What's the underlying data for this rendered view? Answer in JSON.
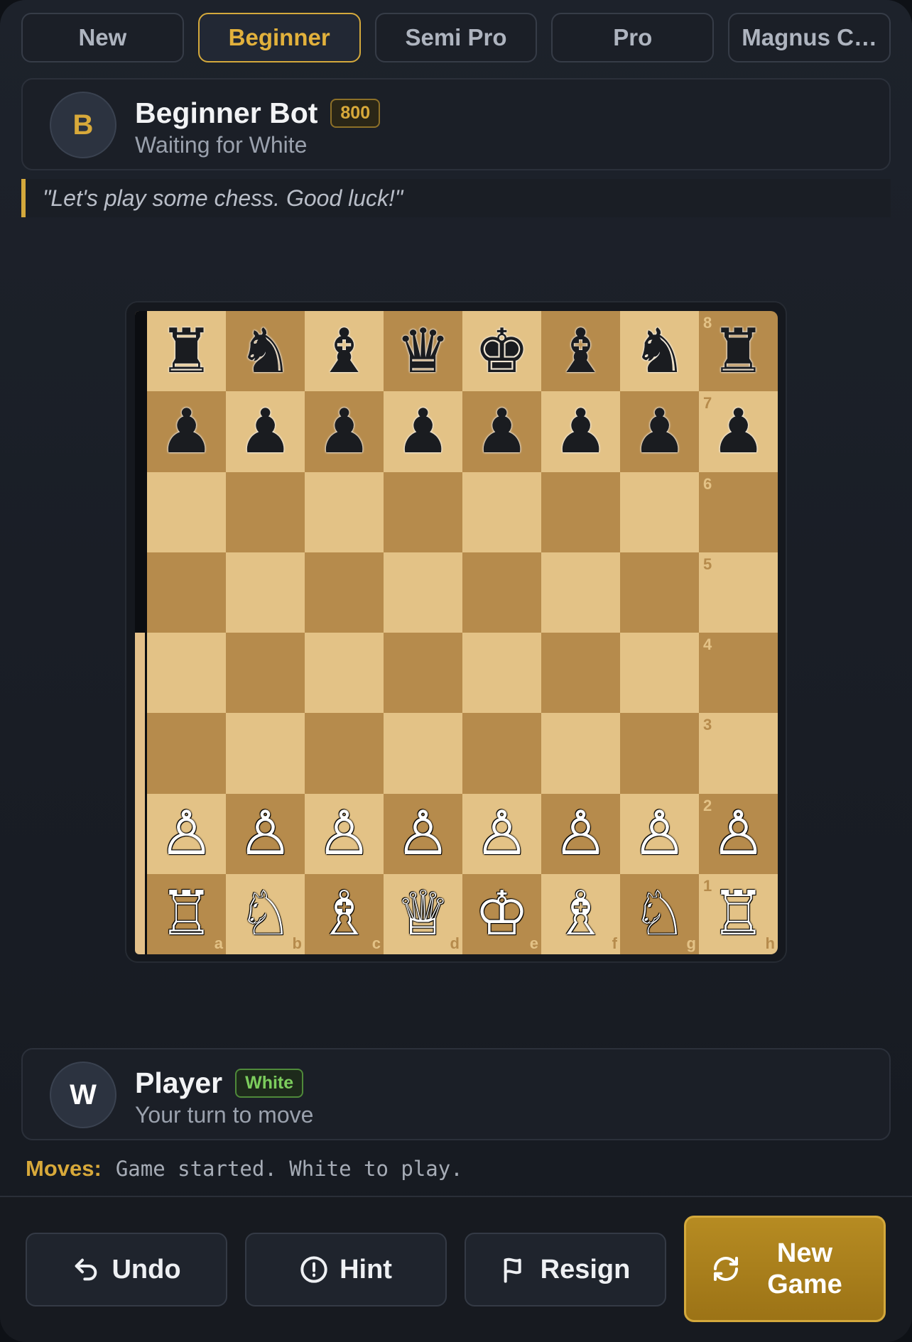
{
  "tabs": [
    {
      "label": "New",
      "active": false
    },
    {
      "label": "Beginner",
      "active": true
    },
    {
      "label": "Semi Pro",
      "active": false
    },
    {
      "label": "Pro",
      "active": false
    },
    {
      "label": "Magnus C…",
      "active": false
    }
  ],
  "opponent": {
    "avatar_letter": "B",
    "name": "Beginner Bot",
    "rating": "800",
    "status": "Waiting for White",
    "quote": "\"Let's play some chess. Good luck!\""
  },
  "player": {
    "avatar_letter": "W",
    "name": "Player",
    "side": "White",
    "status": "Your turn to move"
  },
  "board": {
    "ranks": [
      "8",
      "7",
      "6",
      "5",
      "4",
      "3",
      "2",
      "1"
    ],
    "files": [
      "a",
      "b",
      "c",
      "d",
      "e",
      "f",
      "g",
      "h"
    ],
    "position": [
      [
        "r",
        "n",
        "b",
        "q",
        "k",
        "b",
        "n",
        "r"
      ],
      [
        "p",
        "p",
        "p",
        "p",
        "p",
        "p",
        "p",
        "p"
      ],
      [
        "",
        "",
        "",
        "",
        "",
        "",
        "",
        ""
      ],
      [
        "",
        "",
        "",
        "",
        "",
        "",
        "",
        ""
      ],
      [
        "",
        "",
        "",
        "",
        "",
        "",
        "",
        ""
      ],
      [
        "",
        "",
        "",
        "",
        "",
        "",
        "",
        ""
      ],
      [
        "P",
        "P",
        "P",
        "P",
        "P",
        "P",
        "P",
        "P"
      ],
      [
        "R",
        "N",
        "B",
        "Q",
        "K",
        "B",
        "N",
        "R"
      ]
    ],
    "eval_black_fraction": 0.5
  },
  "moves": {
    "label": "Moves:",
    "text": "Game started. White to play."
  },
  "actions": {
    "undo": "Undo",
    "hint": "Hint",
    "resign": "Resign",
    "new_game": "New Game"
  },
  "colors": {
    "accent": "#d4a93c",
    "light_square": "#e3c286",
    "dark_square": "#b68b4c",
    "background": "#1d222b"
  }
}
